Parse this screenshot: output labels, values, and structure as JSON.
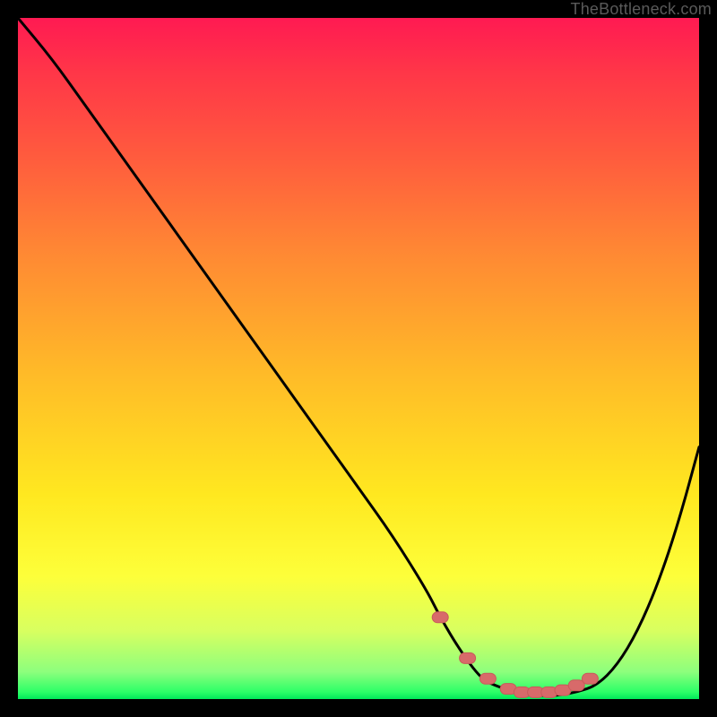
{
  "attribution": "TheBottleneck.com",
  "colors": {
    "page_bg": "#000000",
    "curve": "#000000",
    "marker_fill": "#d86a6a",
    "marker_stroke": "#c85a5a",
    "gradient_stops": [
      {
        "pct": 0,
        "color": "#ff1a52"
      },
      {
        "pct": 8,
        "color": "#ff3648"
      },
      {
        "pct": 20,
        "color": "#ff5a3e"
      },
      {
        "pct": 35,
        "color": "#ff8a33"
      },
      {
        "pct": 52,
        "color": "#ffba28"
      },
      {
        "pct": 70,
        "color": "#ffe820"
      },
      {
        "pct": 82,
        "color": "#fdff3a"
      },
      {
        "pct": 90,
        "color": "#d8ff60"
      },
      {
        "pct": 96,
        "color": "#8dff7d"
      },
      {
        "pct": 99,
        "color": "#2bff67"
      },
      {
        "pct": 100,
        "color": "#00e85a"
      }
    ]
  },
  "chart_data": {
    "type": "line",
    "title": "",
    "xlabel": "",
    "ylabel": "",
    "xlim": [
      0,
      100
    ],
    "ylim": [
      0,
      100
    ],
    "x": [
      0,
      5,
      10,
      15,
      20,
      25,
      30,
      35,
      40,
      45,
      50,
      55,
      60,
      62,
      65,
      68,
      70,
      73,
      76,
      79,
      82,
      85,
      88,
      91,
      94,
      97,
      100
    ],
    "y": [
      100,
      94,
      87,
      80,
      73,
      66,
      59,
      52,
      45,
      38,
      31,
      24,
      16,
      12,
      7,
      3,
      2,
      1,
      0.5,
      0.5,
      1,
      2,
      5,
      10,
      17,
      26,
      37
    ],
    "note": "x and y are percentages of the plot area; y=0 is bottom (green) and y=100 is top (red). The curve descends nearly linearly from top-left, reaches a flat minimum around x≈73–80, then rises to the right edge.",
    "markers": {
      "x": [
        62,
        66,
        69,
        72,
        74,
        76,
        78,
        80,
        82,
        84
      ],
      "y": [
        12,
        6,
        3,
        1.5,
        1,
        1,
        1,
        1.3,
        2,
        3
      ],
      "note": "Rounded dash-like markers clustered along the valley floor of the curve, colored salmon."
    }
  }
}
